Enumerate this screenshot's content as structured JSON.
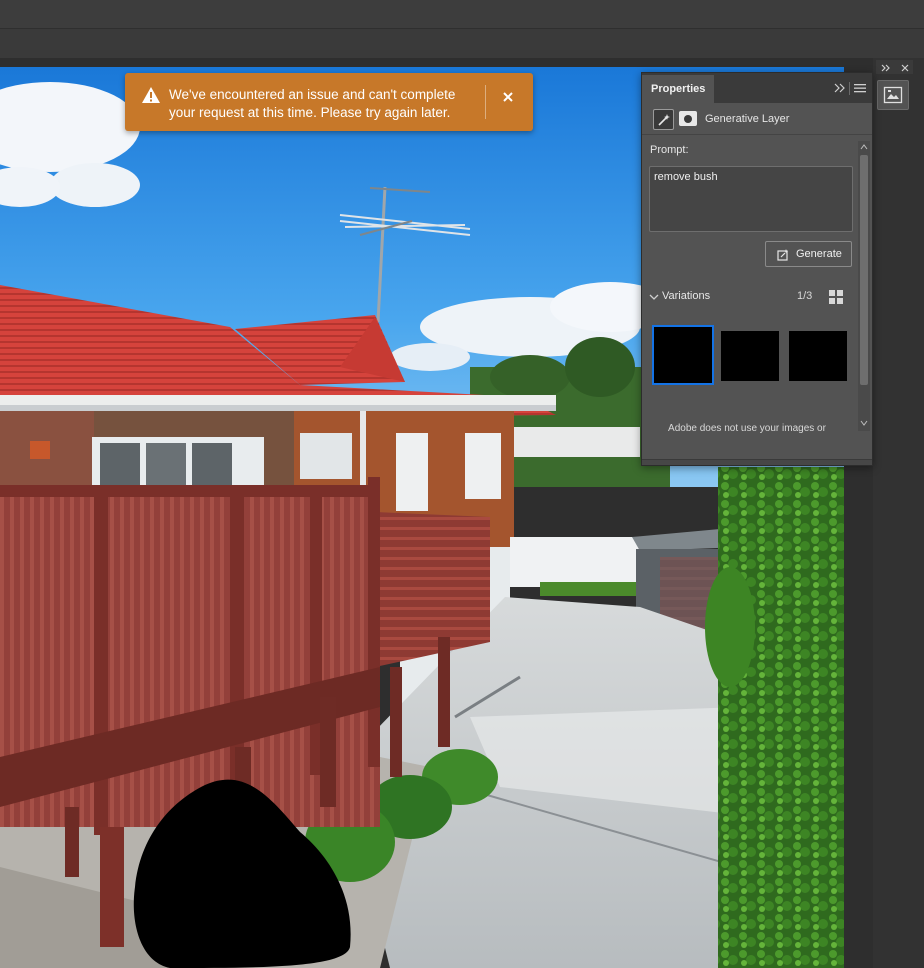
{
  "toast": {
    "message": "We've encountered an issue and can't complete your request at this time. Please try again later.",
    "icon": "warning-icon",
    "close_icon": "close-icon",
    "color": "#c77829"
  },
  "properties_panel": {
    "tab_label": "Properties",
    "layer_type": "Generative Layer",
    "prompt_label": "Prompt:",
    "prompt_value": "remove bush",
    "generate_label": "Generate",
    "variations_label": "Variations",
    "variations_count": "1/3",
    "disclaimer": "Adobe does not use your images or",
    "selected_variation": 1,
    "accent_color": "#1473e6"
  },
  "canvas": {
    "description_icon": "photo-document"
  }
}
